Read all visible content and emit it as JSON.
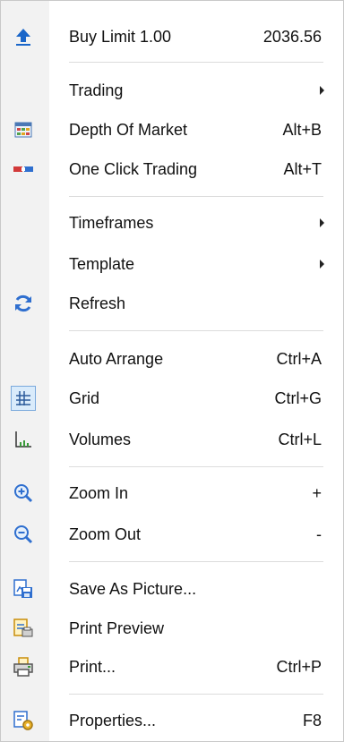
{
  "menu": {
    "items": [
      {
        "label": "Buy Limit 1.00",
        "shortcut": "2036.56",
        "icon": "buy-limit-arrow-icon"
      },
      {
        "label": "Trading",
        "submenu": true
      },
      {
        "label": "Depth Of Market",
        "shortcut": "Alt+B",
        "icon": "depth-of-market-icon"
      },
      {
        "label": "One Click Trading",
        "shortcut": "Alt+T",
        "icon": "one-click-trading-icon"
      },
      {
        "label": "Timeframes",
        "submenu": true
      },
      {
        "label": "Template",
        "submenu": true
      },
      {
        "label": "Refresh",
        "icon": "refresh-icon"
      },
      {
        "label": "Auto Arrange",
        "shortcut": "Ctrl+A"
      },
      {
        "label": "Grid",
        "shortcut": "Ctrl+G",
        "icon": "grid-icon",
        "checked": true
      },
      {
        "label": "Volumes",
        "shortcut": "Ctrl+L",
        "icon": "volumes-icon"
      },
      {
        "label": "Zoom In",
        "shortcut": "+",
        "icon": "zoom-in-icon"
      },
      {
        "label": "Zoom Out",
        "shortcut": "-",
        "icon": "zoom-out-icon"
      },
      {
        "label": "Save As Picture...",
        "icon": "save-as-picture-icon"
      },
      {
        "label": "Print Preview",
        "icon": "print-preview-icon"
      },
      {
        "label": "Print...",
        "shortcut": "Ctrl+P",
        "icon": "printer-icon"
      },
      {
        "label": "Properties...",
        "shortcut": "F8",
        "icon": "properties-icon"
      }
    ]
  }
}
